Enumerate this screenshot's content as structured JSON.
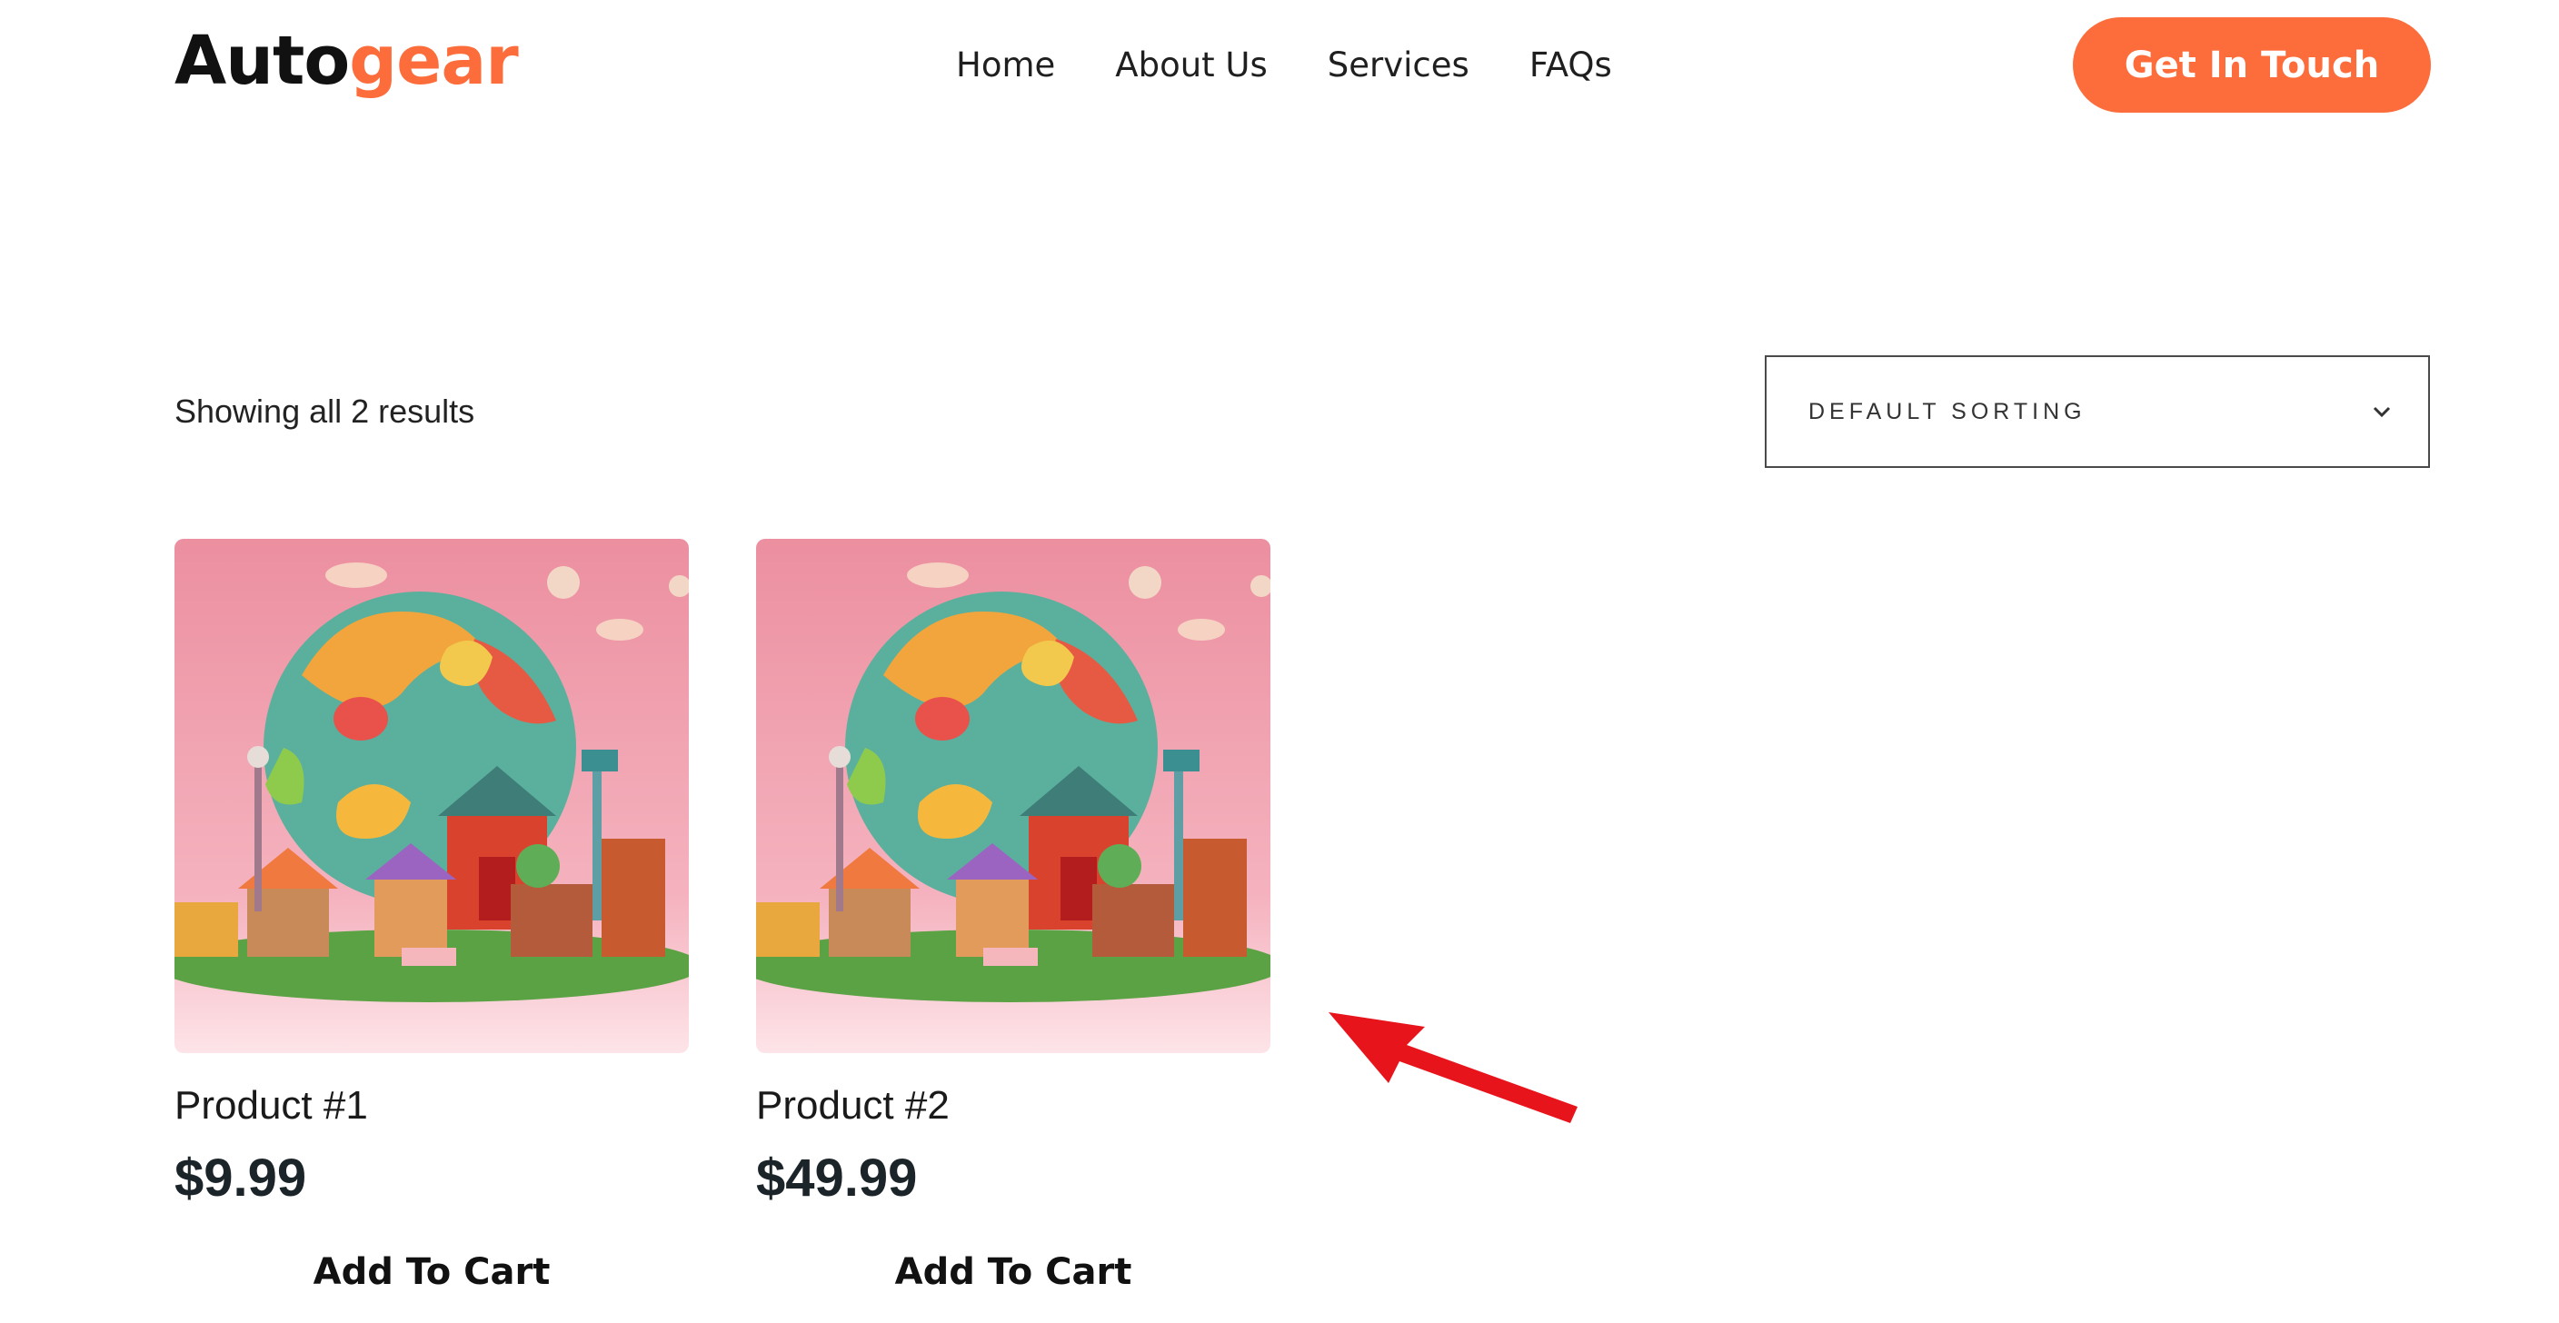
{
  "header": {
    "logo_part1": "Auto",
    "logo_part2": "gear",
    "nav": [
      "Home",
      "About Us",
      "Services",
      "FAQs"
    ],
    "cta": "Get In Touch"
  },
  "toolbar": {
    "result_count": "Showing all 2 results",
    "sorting_label": "DEFAULT SORTING"
  },
  "products": [
    {
      "name": "Product #1",
      "price": "$9.99",
      "button": "Add To Cart"
    },
    {
      "name": "Product #2",
      "price": "$49.99",
      "button": "Add To Cart"
    }
  ],
  "colors": {
    "accent": "#fd6d3b",
    "annotation_arrow": "#e8141c"
  }
}
